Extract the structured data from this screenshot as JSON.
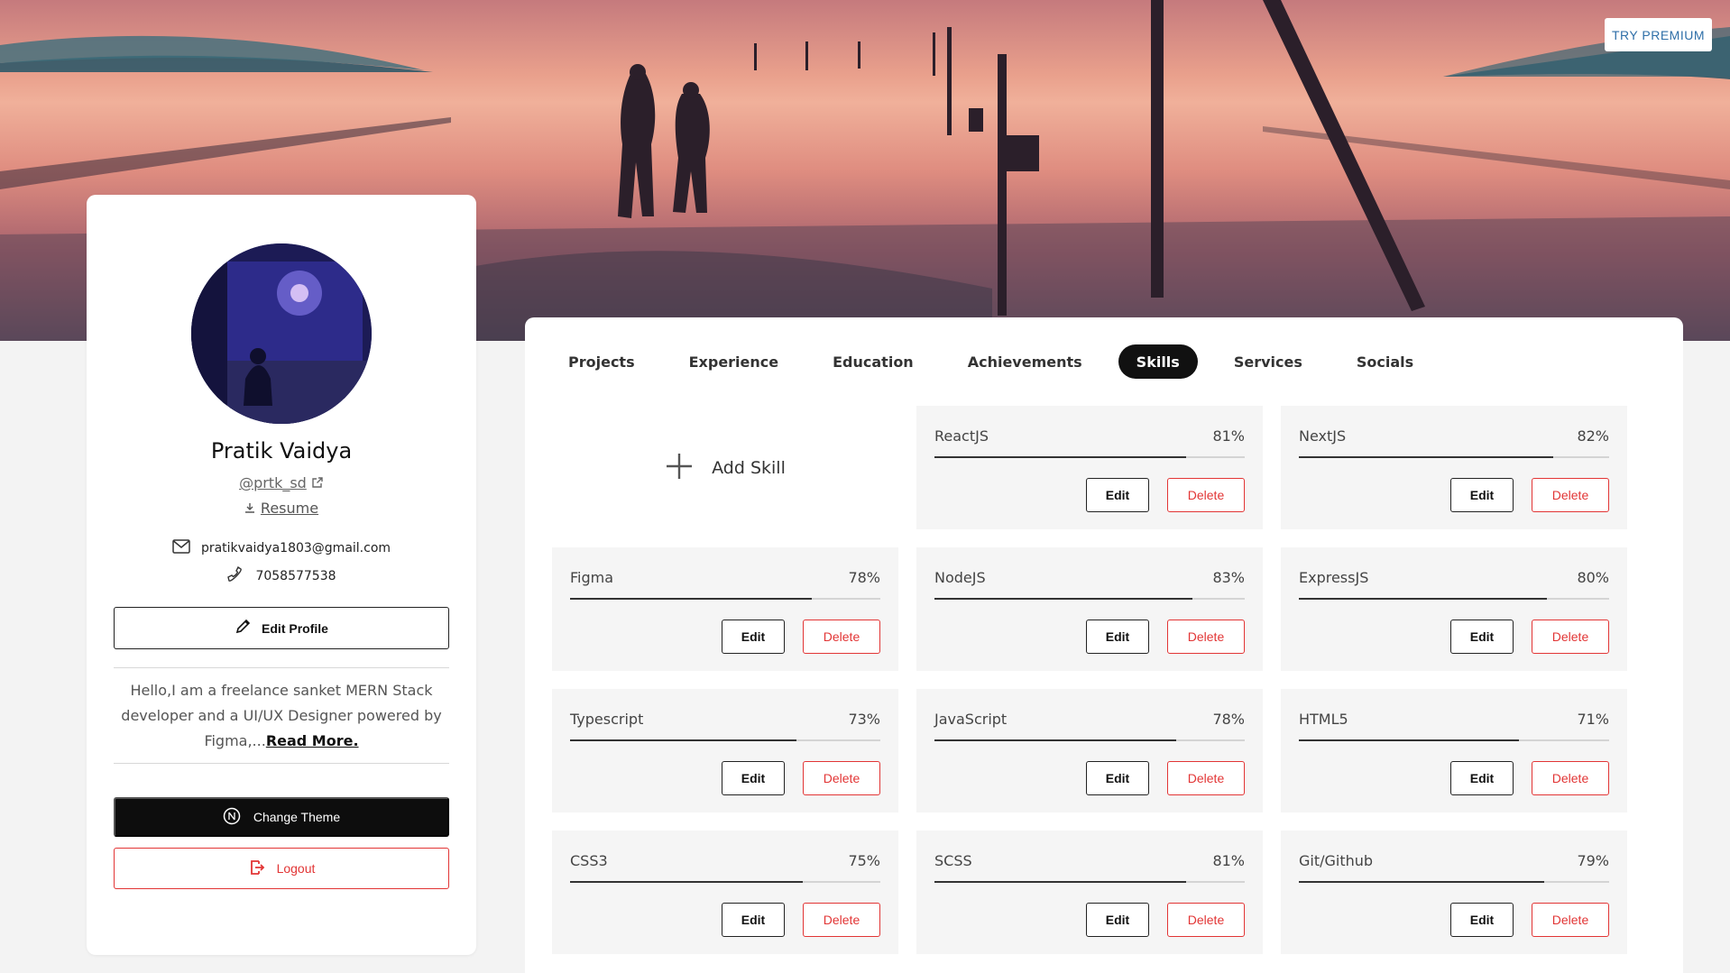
{
  "header": {
    "premium_label": "TRY PREMIUM"
  },
  "profile": {
    "name": "Pratik Vaidya",
    "handle": "@prtk_sd",
    "resume_label": "Resume",
    "email": "pratikvaidya1803@gmail.com",
    "phone": "7058577538",
    "edit_label": "Edit Profile",
    "bio": "Hello,I am a freelance sanket MERN Stack developer and a UI/UX Designer powered by Figma,...",
    "read_more": "Read More.",
    "theme_label": "Change Theme",
    "logout_label": "Logout"
  },
  "tabs": [
    {
      "label": "Projects"
    },
    {
      "label": "Experience"
    },
    {
      "label": "Education"
    },
    {
      "label": "Achievements"
    },
    {
      "label": "Skills",
      "active": true
    },
    {
      "label": "Services"
    },
    {
      "label": "Socials"
    }
  ],
  "add_skill_label": "Add Skill",
  "edit_label": "Edit",
  "delete_label": "Delete",
  "skills": [
    {
      "name": "ReactJS",
      "percent": 81
    },
    {
      "name": "NextJS",
      "percent": 82
    },
    {
      "name": "Figma",
      "percent": 78
    },
    {
      "name": "NodeJS",
      "percent": 83
    },
    {
      "name": "ExpressJS",
      "percent": 80
    },
    {
      "name": "Typescript",
      "percent": 73
    },
    {
      "name": "JavaScript",
      "percent": 78
    },
    {
      "name": "HTML5",
      "percent": 71
    },
    {
      "name": "CSS3",
      "percent": 75
    },
    {
      "name": "SCSS",
      "percent": 81
    },
    {
      "name": "Git/Github",
      "percent": 79
    }
  ],
  "colors": {
    "accent_red": "#e23535",
    "dark": "#111111",
    "link_blue": "#2f6fa8"
  },
  "icons": [
    "external-link-icon",
    "download-icon",
    "mail-icon",
    "phone-icon",
    "pencil-icon",
    "theme-icon",
    "logout-icon",
    "plus-icon"
  ]
}
